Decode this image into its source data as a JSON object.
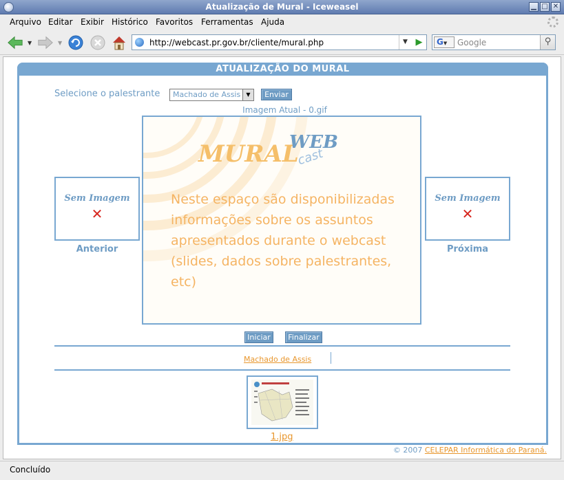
{
  "window": {
    "title": "Atualização de Mural - Iceweasel"
  },
  "menu": {
    "items": [
      {
        "label": "Arquivo"
      },
      {
        "label": "Editar"
      },
      {
        "label": "Exibir"
      },
      {
        "label": "Histórico"
      },
      {
        "label": "Favoritos"
      },
      {
        "label": "Ferramentas"
      },
      {
        "label": "Ajuda"
      }
    ]
  },
  "navbar": {
    "url": "http://webcast.pr.gov.br/cliente/mural.php",
    "search_placeholder": "Google",
    "search_engine": "G"
  },
  "page": {
    "header": "ATUALIZAÇÃO DO MURAL",
    "select_label": "Selecione o palestrante",
    "select_value": "Machado de Assis",
    "send_button": "Enviar",
    "current_image_label": "Imagem Atual - 0.gif",
    "main_image": {
      "logo_mural": "MURAL",
      "logo_web": "WEB",
      "logo_cast": "cast",
      "text": "Neste espaço são disponibilizadas informações sobre os assuntos apresentados durante o webcast (slides, dados sobre palestrantes, etc)"
    },
    "prev": {
      "placeholder": "Sem Imagem",
      "label": "Anterior"
    },
    "next": {
      "placeholder": "Sem Imagem",
      "label": "Próxima"
    },
    "start_button": "Iniciar",
    "finish_button": "Finalizar",
    "speaker_link": "Machado de Assis",
    "thumbnail_link": "1.jpg",
    "footer_copyright": "© 2007",
    "footer_link": "CELEPAR Informática do Paraná."
  },
  "status": {
    "text": "Concluído"
  },
  "colors": {
    "accent": "#78a7d1",
    "link": "#e8962c",
    "title_bar": "#6f8bbf"
  }
}
